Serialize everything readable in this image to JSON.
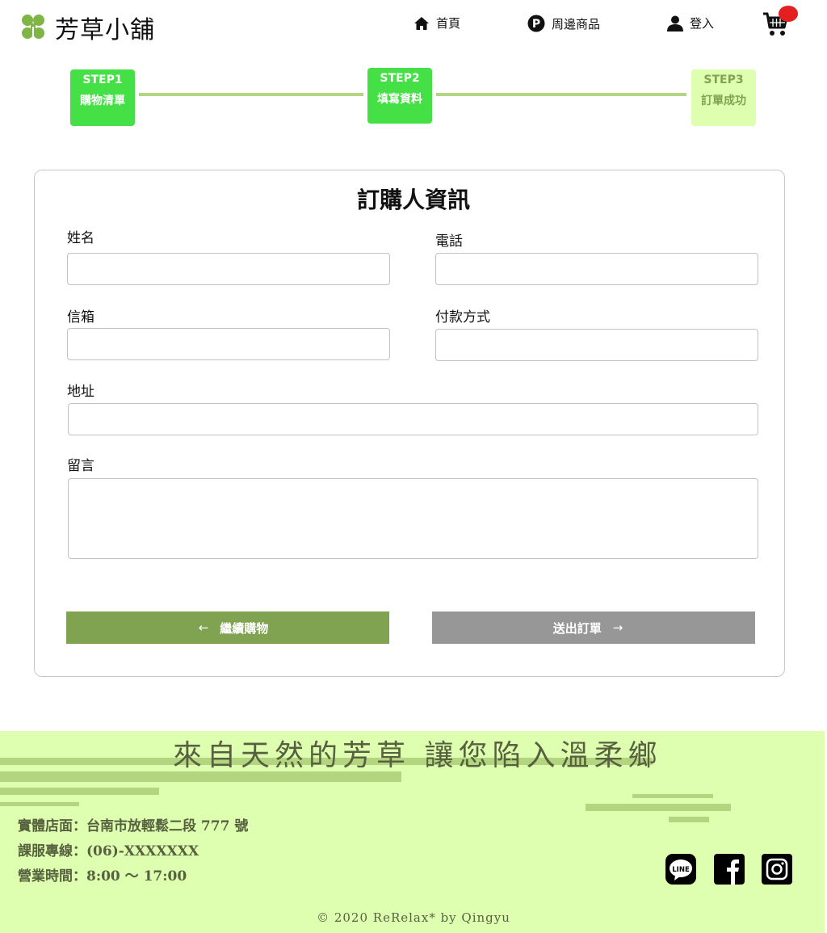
{
  "brand": {
    "name": "芳草小舖",
    "logo_icon": "clover-icon",
    "color": "#7fb447"
  },
  "nav": {
    "home": {
      "label": "首頁",
      "icon": "home-icon"
    },
    "products": {
      "label": "周邊商品",
      "icon": "p-circle-icon"
    },
    "login": {
      "label": "登入",
      "icon": "user-icon"
    },
    "cart": {
      "icon": "cart-icon",
      "badge_color": "#e41f1f"
    }
  },
  "steps": [
    {
      "num": "STEP1",
      "label": "購物清單",
      "state": "done"
    },
    {
      "num": "STEP2",
      "label": "填寫資料",
      "state": "current"
    },
    {
      "num": "STEP3",
      "label": "訂單成功",
      "state": "upcoming"
    }
  ],
  "form": {
    "title": "訂購人資訊",
    "name_label": "姓名",
    "phone_label": "電話",
    "email_label": "信箱",
    "payment_label": "付款方式",
    "address_label": "地址",
    "message_label": "留言",
    "name_value": "",
    "phone_value": "",
    "email_value": "",
    "payment_value": "",
    "address_value": "",
    "message_value": ""
  },
  "buttons": {
    "continue_label": "繼續購物",
    "continue_arrow": "←",
    "submit_label": "送出訂單",
    "submit_arrow": "→"
  },
  "footer": {
    "slogan": "來自天然的芳草 讓您陷入溫柔鄉",
    "address": "實體店面：台南市放輕鬆二段 777 號",
    "hotline": "課服專線：(06)-XXXXXXX",
    "hours": "營業時間：8:00 ～ 17:00",
    "social_icons": [
      "line-icon",
      "facebook-icon",
      "instagram-icon"
    ],
    "copyright": "© 2020 ReRelax* by Qingyu"
  },
  "colors": {
    "step_active": "#45e045",
    "step_upcoming": "#ddffaf",
    "step_line": "#b3d57f",
    "continue_button": "#7fa350",
    "submit_button": "#979797",
    "footer_bg": "#ddffaf",
    "footer_text": "#57613f"
  }
}
